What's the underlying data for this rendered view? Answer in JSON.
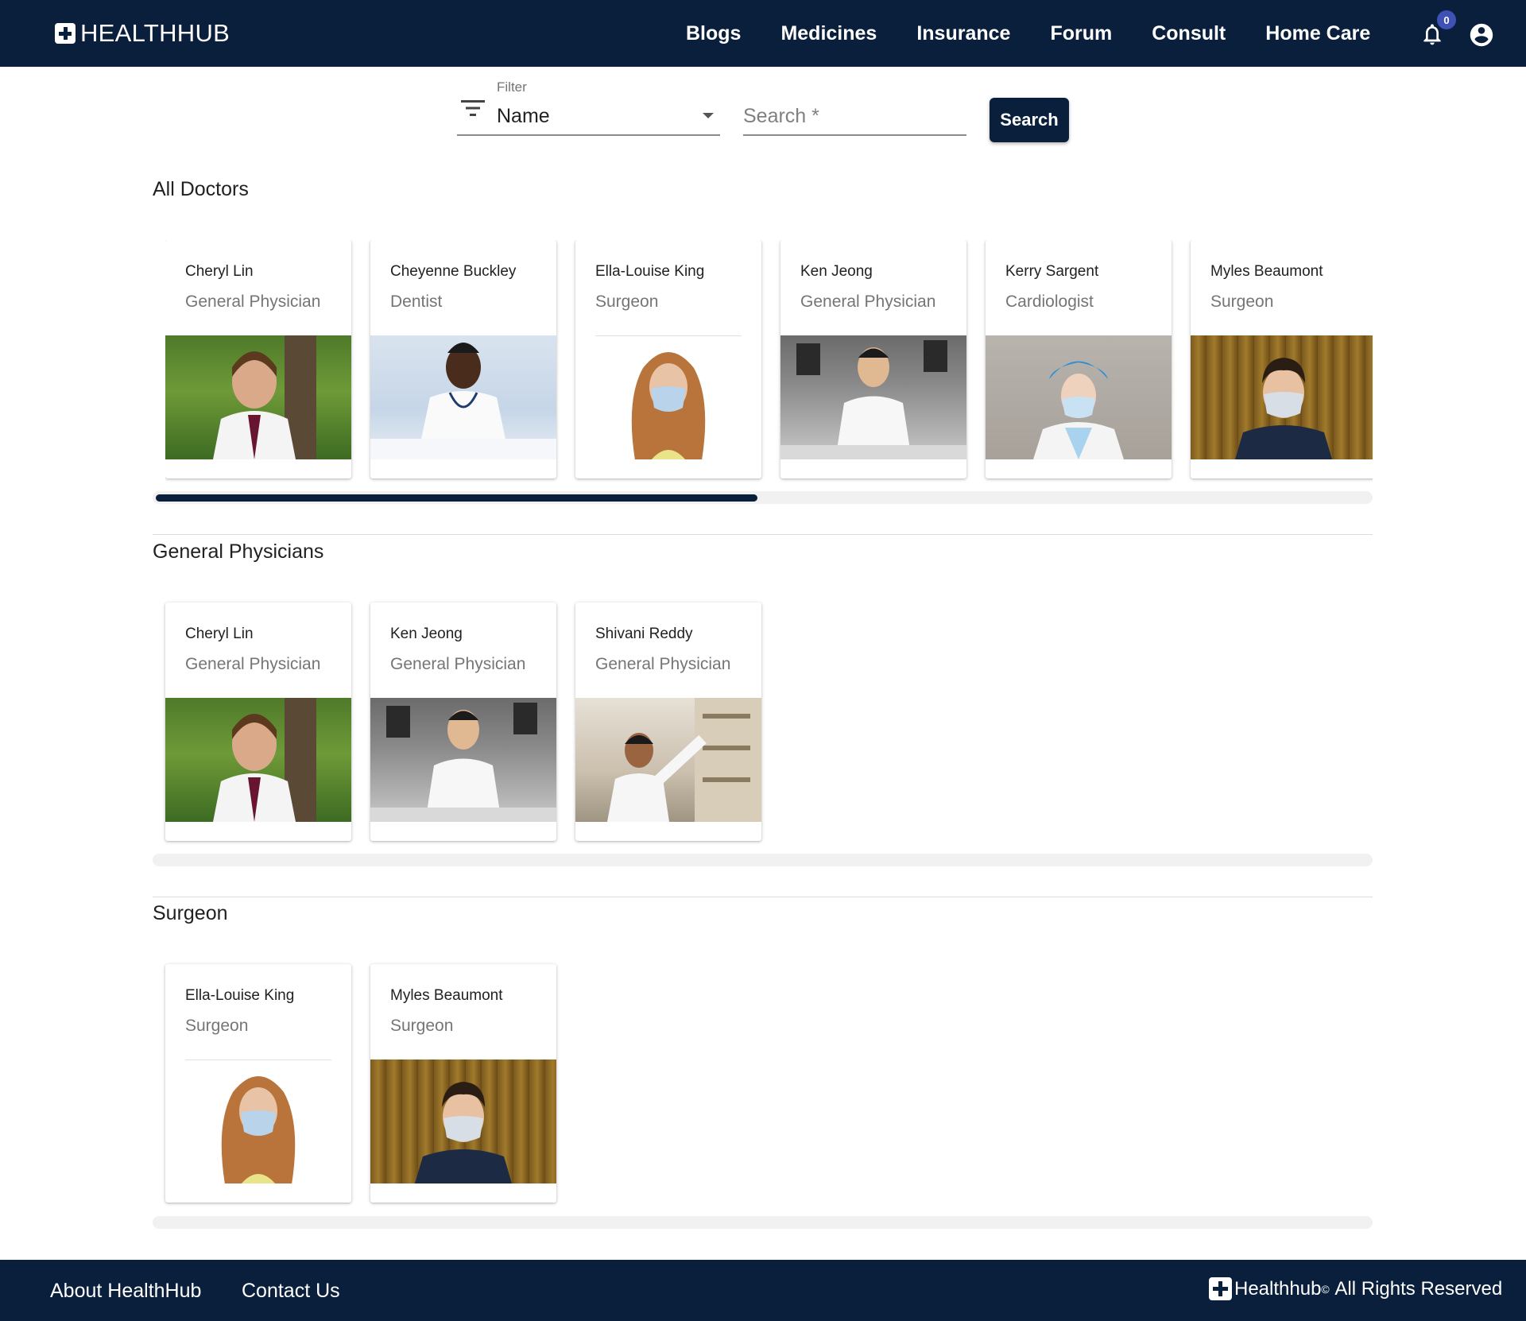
{
  "header": {
    "logo_text": "HEALTHHUB",
    "nav": [
      "Blogs",
      "Medicines",
      "Insurance",
      "Forum",
      "Consult",
      "Home Care"
    ],
    "notification_count": "0"
  },
  "filter": {
    "label": "Filter",
    "value": "Name",
    "search_placeholder": "Search *",
    "search_button": "Search"
  },
  "sections": [
    {
      "title": "All Doctors",
      "scroll_thumb_fraction": 0.5,
      "doctors": [
        {
          "name": "Cheryl Lin",
          "specialty": "General Physician"
        },
        {
          "name": "Cheyenne Buckley",
          "specialty": "Dentist"
        },
        {
          "name": "Ella-Louise King",
          "specialty": "Surgeon"
        },
        {
          "name": "Ken Jeong",
          "specialty": "General Physician"
        },
        {
          "name": "Kerry Sargent",
          "specialty": "Cardiologist"
        },
        {
          "name": "Myles Beaumont",
          "specialty": "Surgeon"
        }
      ]
    },
    {
      "title": "General Physicians",
      "doctors": [
        {
          "name": "Cheryl Lin",
          "specialty": "General Physician"
        },
        {
          "name": "Ken Jeong",
          "specialty": "General Physician"
        },
        {
          "name": "Shivani Reddy",
          "specialty": "General Physician"
        }
      ]
    },
    {
      "title": "Surgeon",
      "doctors": [
        {
          "name": "Ella-Louise King",
          "specialty": "Surgeon"
        },
        {
          "name": "Myles Beaumont",
          "specialty": "Surgeon"
        }
      ]
    }
  ],
  "footer": {
    "about": "About HealthHub",
    "contact": "Contact Us",
    "brand": "Healthhub",
    "registered": "©",
    "rights": "All Rights Reserved"
  },
  "colors": {
    "primary": "#0a1f3c",
    "badge": "#3f51b5"
  }
}
